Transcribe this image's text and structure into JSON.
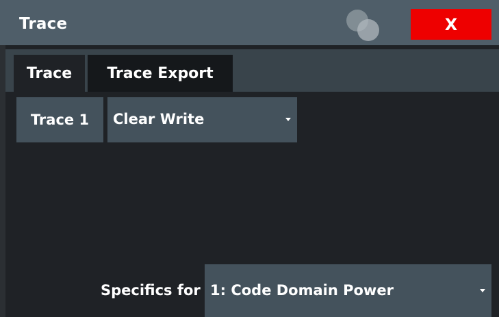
{
  "window": {
    "title": "Trace",
    "close_label": "X"
  },
  "tabs": [
    {
      "label": "Trace",
      "active": true
    },
    {
      "label": "Trace Export",
      "active": false
    }
  ],
  "trace": {
    "label": "Trace 1",
    "mode_value": "Clear Write"
  },
  "specifics": {
    "label": "Specifics for",
    "value": "1: Code Domain Power"
  },
  "colors": {
    "titlebar": "#4f5e69",
    "close_button": "#ee0000",
    "panel": "#1f2226",
    "control": "#44525c"
  }
}
